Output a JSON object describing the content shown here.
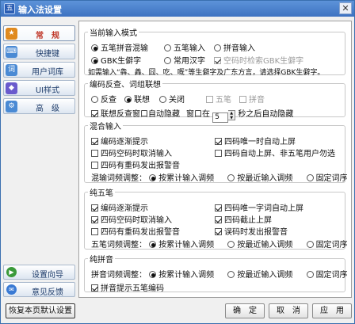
{
  "window": {
    "title": "输入法设置",
    "close_glyph": "✕"
  },
  "sidebar": {
    "items": [
      {
        "label": "常　规",
        "icon": "general-icon",
        "color": "#e08a1e",
        "active": true
      },
      {
        "label": "快捷键",
        "icon": "keyboard-icon",
        "color": "#4a8ad4"
      },
      {
        "label": "用户词库",
        "icon": "dictionary-icon",
        "color": "#4a8ad4"
      },
      {
        "label": "UI样式",
        "icon": "ui-style-icon",
        "color": "#6a5acd"
      },
      {
        "label": "高　级",
        "icon": "advanced-icon",
        "color": "#4a8ad4"
      }
    ],
    "bottom": [
      {
        "label": "设置向导",
        "icon": "wizard-icon",
        "color": "#3a9a3a"
      },
      {
        "label": "意见反馈",
        "icon": "feedback-icon",
        "color": "#3a7ad4"
      }
    ]
  },
  "mode": {
    "legend": "当前输入模式",
    "r1": "五笔拼音混输",
    "r2": "五笔输入",
    "r3": "拼音输入",
    "r4": "GBK生僻字",
    "r5": "常用汉字",
    "cb_gbk": "空码时检索GBK生僻字",
    "note": "如需输入“犇、羴、囧、吃、嘅”等生僻字及广东方言，请选择GBK生僻字。"
  },
  "encode": {
    "legend": "编码反查、词组联想",
    "r1": "反查",
    "r2": "联想",
    "r3": "关闭",
    "cb1": "五笔",
    "cb2": "拼音",
    "hide_label": "联想反查窗口自动隐藏",
    "window_label": "窗口在",
    "seconds": "5",
    "after_label": "秒之后自动隐藏"
  },
  "mixed": {
    "legend": "混合输入",
    "a1": "编码逐渐提示",
    "a2": "四码唯一时自动上屏",
    "b1": "四码空码时取消输入",
    "b2": "四码自动上屏、非五笔用户勿选",
    "c1": "四码有重码发出报警音",
    "freq_label": "混输词频调整：",
    "f1": "按累计输入调频",
    "f2": "按最近输入调频",
    "f3": "固定词序"
  },
  "wubi": {
    "legend": "纯五笔",
    "a1": "编码逐渐提示",
    "a2": "四码唯一字词自动上屏",
    "b1": "四码空码时取消输入",
    "b2": "四码截止上屏",
    "c1": "四码有重码发出报警音",
    "c2": "误码时发出报警音",
    "freq_label": "五笔词频调整：",
    "f1": "按累计输入调频",
    "f2": "按最近输入调频",
    "f3": "固定词序"
  },
  "pinyin": {
    "legend": "纯拼音",
    "freq_label": "拼音词频调整：",
    "f1": "按累计输入调频",
    "f2": "按最近输入调频",
    "f3": "固定词序",
    "cb1": "拼音提示五笔编码"
  },
  "footer": {
    "reset": "恢复本页默认设置",
    "ok": "确　定",
    "cancel": "取　消",
    "apply": "应　用"
  }
}
